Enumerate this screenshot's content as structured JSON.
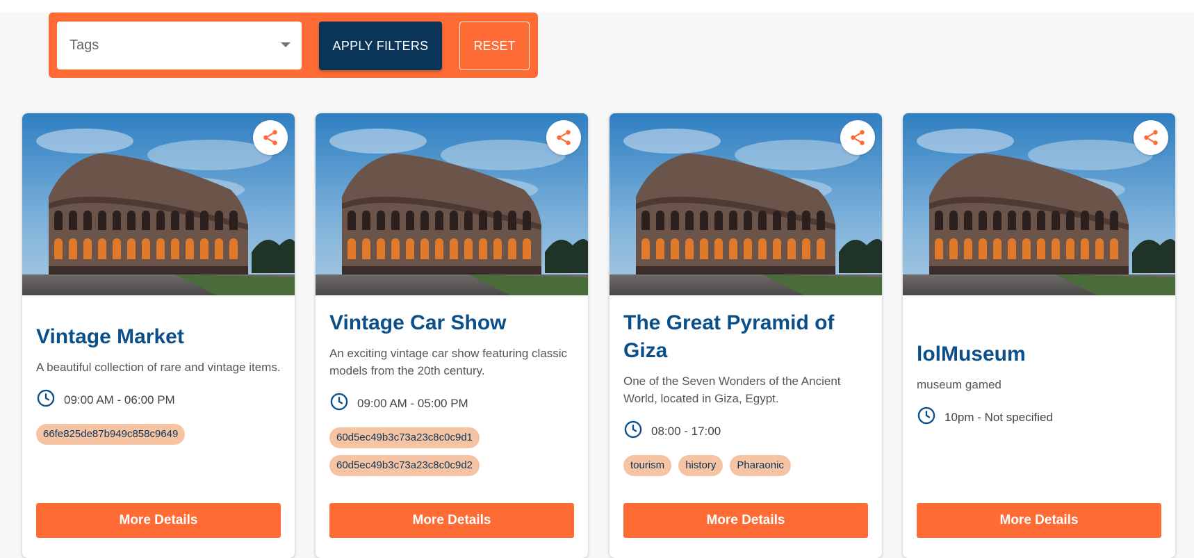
{
  "filters": {
    "tags_placeholder": "Tags",
    "apply_label": "APPLY FILTERS",
    "reset_label": "RESET"
  },
  "colors": {
    "accent": "#ff6b35",
    "navy": "#0b3558",
    "title_blue": "#0b4f8a",
    "tag_bg": "#f6c3a3"
  },
  "cards": [
    {
      "title": "Vintage Market",
      "description": "A beautiful collection of rare and vintage items.",
      "time": "09:00 AM - 06:00 PM",
      "tags": [
        "66fe825de87b949c858c9649"
      ],
      "button": "More Details"
    },
    {
      "title": "Vintage Car Show",
      "description": "An exciting vintage car show featuring classic models from the 20th century.",
      "time": "09:00 AM - 05:00 PM",
      "tags": [
        "60d5ec49b3c73a23c8c0c9d1",
        "60d5ec49b3c73a23c8c0c9d2"
      ],
      "button": "More Details"
    },
    {
      "title": "The Great Pyramid of Giza",
      "description": "One of the Seven Wonders of the Ancient World, located in Giza, Egypt.",
      "time": "08:00 - 17:00",
      "tags": [
        "tourism",
        "history",
        "Pharaonic"
      ],
      "button": "More Details"
    },
    {
      "title": "lolMuseum",
      "description": "museum gamed",
      "time": "10pm - Not specified",
      "tags": [],
      "button": "More Details"
    }
  ]
}
